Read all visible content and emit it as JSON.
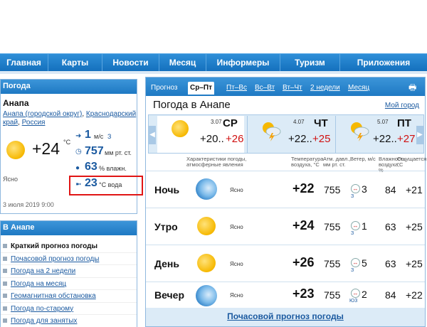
{
  "nav": {
    "items": [
      "Главная",
      "Карты",
      "Новости",
      "Месяц",
      "Информеры",
      "Туризм",
      "Приложения"
    ]
  },
  "current": {
    "panel_title": "Погода",
    "city": "Анапа",
    "region_parts": [
      "Анапа (городской округ)",
      "Краснодарский край",
      "Россия"
    ],
    "temp": "+24",
    "temp_unit": "°C",
    "wind_value": "1",
    "wind_unit": "м/с",
    "wind_dir": "З",
    "pressure_value": "757",
    "pressure_unit": "мм рт. ст.",
    "humidity_value": "63",
    "humidity_unit": "% влажн.",
    "water_value": "23",
    "water_unit": "°C вода",
    "condition": "Ясно",
    "datetime": "3 июля 2019 9:00",
    "colors": {
      "accent": "#1e79c3",
      "link": "#1b5aa0",
      "highlight": "#e01515",
      "hot": "#d01010"
    }
  },
  "links_panel": {
    "title": "В Анапе",
    "items": [
      "Краткий прогноз погоды",
      "Почасовой прогноз погоды",
      "Погода на 2 недели",
      "Погода на месяц",
      "Геомагнитная обстановка",
      "Погода по-старому",
      "Погода для занятых"
    ],
    "active_index": 0
  },
  "forecast": {
    "tabs": [
      "Прогноз",
      "Ср–Пт",
      "Пт–Вс",
      "Вс–Вт",
      "Вт–Чт",
      "2 недели",
      "Месяц"
    ],
    "active_tab": 1,
    "print_icon": "printer-icon",
    "title": "Погода в Анапе",
    "my_city": "Мой город",
    "days": [
      {
        "date": "3.07",
        "name": "СР",
        "low": "+20..",
        "high": "+26",
        "icon": "sun-icon"
      },
      {
        "date": "4.07",
        "name": "ЧТ",
        "low": "+22..",
        "high": "+25",
        "icon": "storm-icon"
      },
      {
        "date": "5.07",
        "name": "ПТ",
        "low": "+22..",
        "high": "+27",
        "icon": "storm-icon"
      }
    ],
    "headers": {
      "characteristics": "Характеристики погоды, атмосферные явления",
      "temperature": "Температура воздуха, °C",
      "pressure": "Атм. давл., мм рт. ст.",
      "wind": "Ветер, м/с",
      "humidity": "Влажность воздуха, %",
      "feels": "Ощущается, °C"
    },
    "rows": [
      {
        "label": "Ночь",
        "icon": "moon-icon",
        "cond": "Ясно",
        "temp": "+22",
        "pressure": "755",
        "wind": "3",
        "wdir": "З",
        "humidity": "84",
        "feels": "+21"
      },
      {
        "label": "Утро",
        "icon": "sun-icon",
        "cond": "Ясно",
        "temp": "+24",
        "pressure": "755",
        "wind": "1",
        "wdir": "З",
        "humidity": "63",
        "feels": "+25"
      },
      {
        "label": "День",
        "icon": "sun-icon",
        "cond": "Ясно",
        "temp": "+26",
        "pressure": "755",
        "wind": "5",
        "wdir": "З",
        "humidity": "63",
        "feels": "+25"
      },
      {
        "label": "Вечер",
        "icon": "moon-icon",
        "cond": "Ясно",
        "temp": "+23",
        "pressure": "755",
        "wind": "2",
        "wdir": "ЮЗ",
        "humidity": "84",
        "feels": "+22"
      }
    ],
    "hourly_link": "Почасовой прогноз погоды"
  }
}
